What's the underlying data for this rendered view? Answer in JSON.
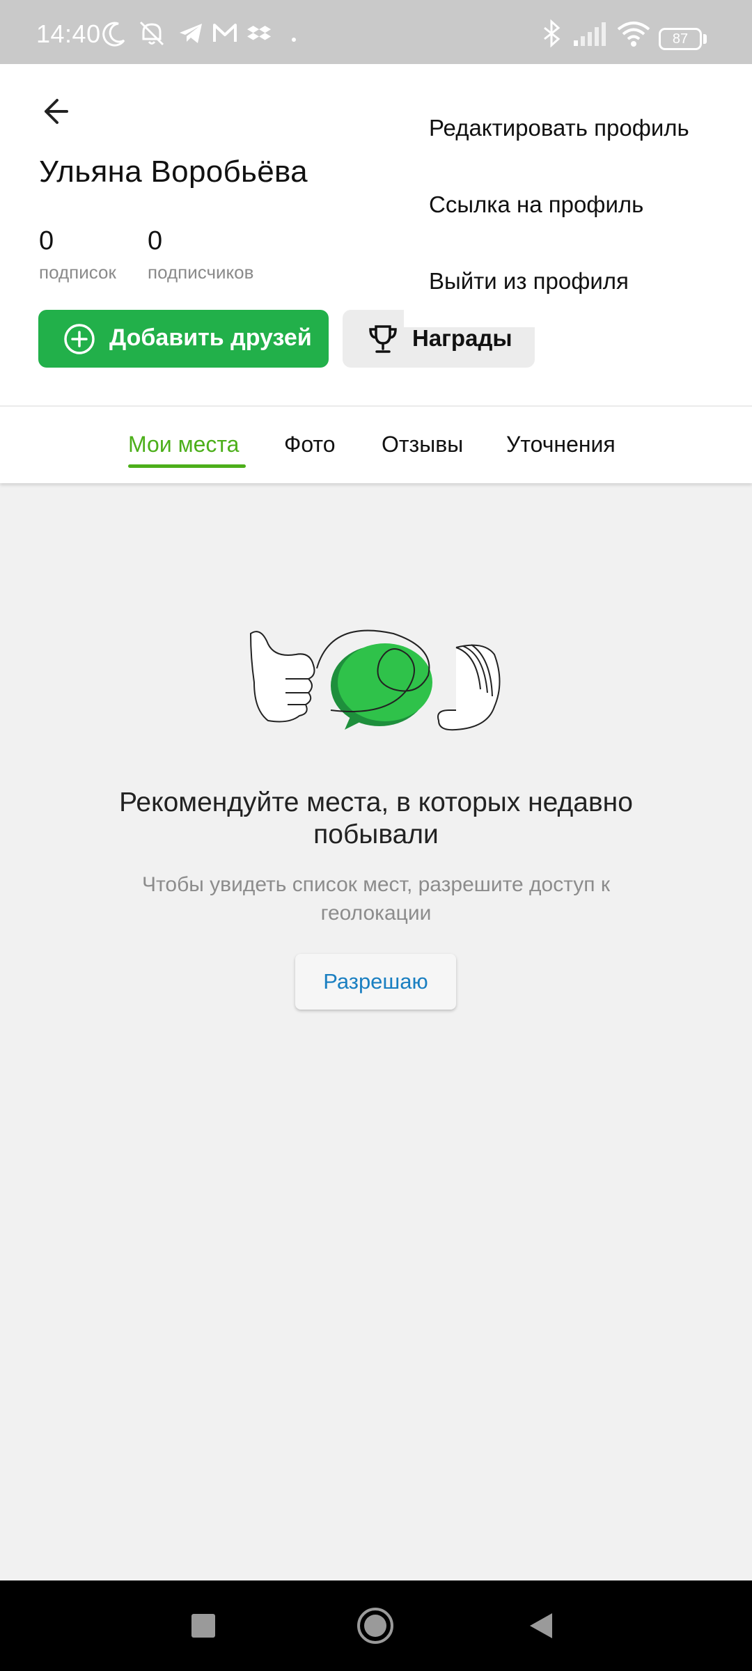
{
  "status_bar": {
    "time": "14:40",
    "battery": "87",
    "left_icons": [
      "moon-icon",
      "muted-alarm-icon",
      "telegram-icon",
      "gmail-icon",
      "dropbox-icon",
      "dot-icon"
    ],
    "right_icons": [
      "bluetooth-icon",
      "signal-icon",
      "wifi-icon",
      "battery-icon"
    ]
  },
  "profile": {
    "name": "Ульяна Воробьёва",
    "subscriptions_count": "0",
    "subscriptions_label": "подписок",
    "subscribers_count": "0",
    "subscribers_label": "подписчиков"
  },
  "buttons": {
    "add_friends": "Добавить друзей",
    "awards": "Награды"
  },
  "menu": {
    "items": [
      "Редактировать профиль",
      "Ссылка на профиль",
      "Выйти из профиля"
    ]
  },
  "tabs": {
    "items": [
      "Мои места",
      "Фото",
      "Отзывы",
      "Уточнения"
    ],
    "active": "Мои места"
  },
  "empty_state": {
    "title": "Рекомендуйте места, в которых недавно побывали",
    "subtitle": "Чтобы увидеть список мест, разрешите доступ к геолокации",
    "button": "Разрешаю"
  },
  "colors": {
    "accent_green": "#22b04a",
    "tab_active": "#4caf1a",
    "link_blue": "#1a7fc1"
  }
}
